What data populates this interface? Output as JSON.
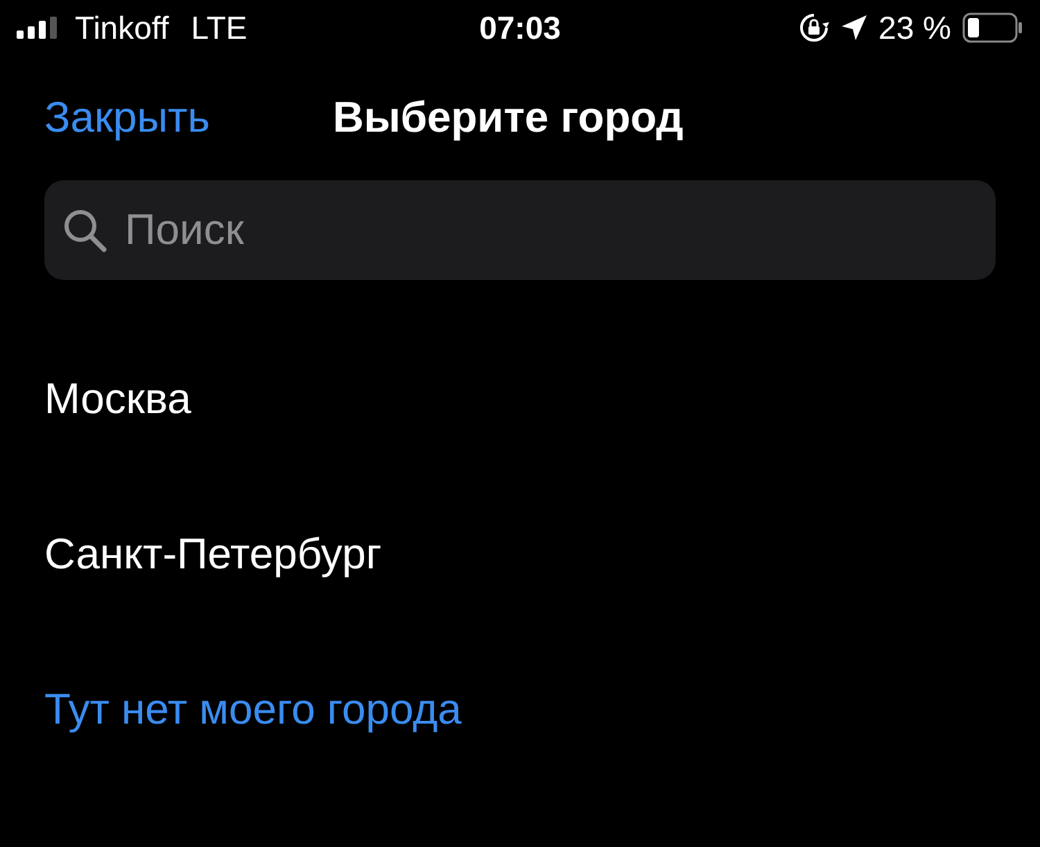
{
  "status_bar": {
    "carrier": "Tinkoff",
    "network": "LTE",
    "time": "07:03",
    "battery_percent": "23 %"
  },
  "nav": {
    "close": "Закрыть",
    "title": "Выберите город"
  },
  "search": {
    "placeholder": "Поиск"
  },
  "cities": [
    "Москва",
    "Санкт-Петербург"
  ],
  "missing_link": "Тут нет моего города"
}
